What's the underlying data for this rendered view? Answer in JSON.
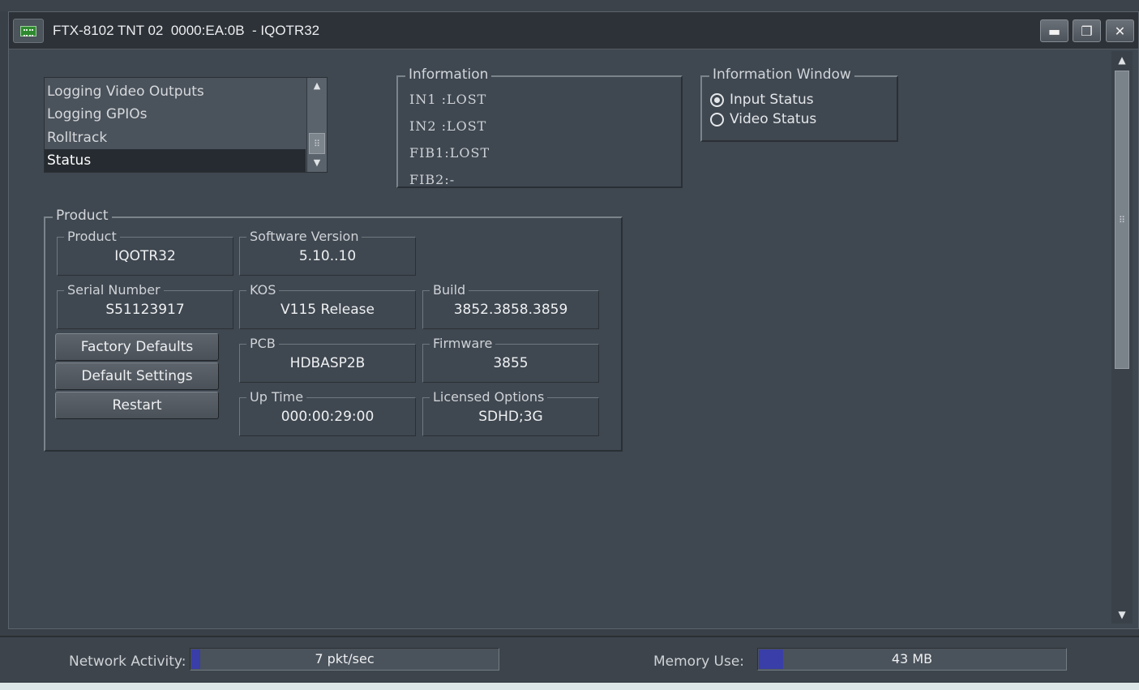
{
  "window": {
    "title": "FTX-8102 TNT 02  0000:EA:0B  - IQOTR32",
    "minimize_glyph": "▬",
    "restore_glyph": "❐",
    "close_glyph": "✕"
  },
  "nav_list": {
    "items": [
      "Logging Video Outputs",
      "Logging GPIOs",
      "Rolltrack",
      "Status"
    ],
    "selected": "Status"
  },
  "information": {
    "label": "Information",
    "lines": [
      "IN1 :LOST",
      "IN2 :LOST",
      "FIB1:LOST",
      "FIB2:-"
    ]
  },
  "information_window": {
    "label": "Information Window",
    "options": [
      "Input Status",
      "Video Status"
    ],
    "selected": "Input Status"
  },
  "product": {
    "label": "Product",
    "fields": {
      "product": {
        "label": "Product",
        "value": "IQOTR32"
      },
      "software_version": {
        "label": "Software Version",
        "value": "5.10..10"
      },
      "serial_number": {
        "label": "Serial Number",
        "value": "S51123917"
      },
      "kos": {
        "label": "KOS",
        "value": "V115 Release"
      },
      "build": {
        "label": "Build",
        "value": "3852.3858.3859"
      },
      "pcb": {
        "label": "PCB",
        "value": "HDBASP2B"
      },
      "firmware": {
        "label": "Firmware",
        "value": "3855"
      },
      "up_time": {
        "label": "Up Time",
        "value": "000:00:29:00"
      },
      "licensed_options": {
        "label": "Licensed Options",
        "value": "SDHD;3G"
      }
    },
    "buttons": {
      "factory_defaults": "Factory Defaults",
      "default_settings": "Default Settings",
      "restart": "Restart"
    }
  },
  "statusbar": {
    "network_label": "Network Activity:",
    "network_value": "7 pkt/sec",
    "network_fill_fraction": 0.03,
    "memory_label": "Memory Use:",
    "memory_value": "43 MB",
    "memory_fill_fraction": 0.08,
    "fill_color": "#3a3ea8"
  },
  "icons": {
    "app": "circuit-board-icon",
    "scroll_up": "▲",
    "scroll_down": "▼",
    "grip": "⠿"
  }
}
